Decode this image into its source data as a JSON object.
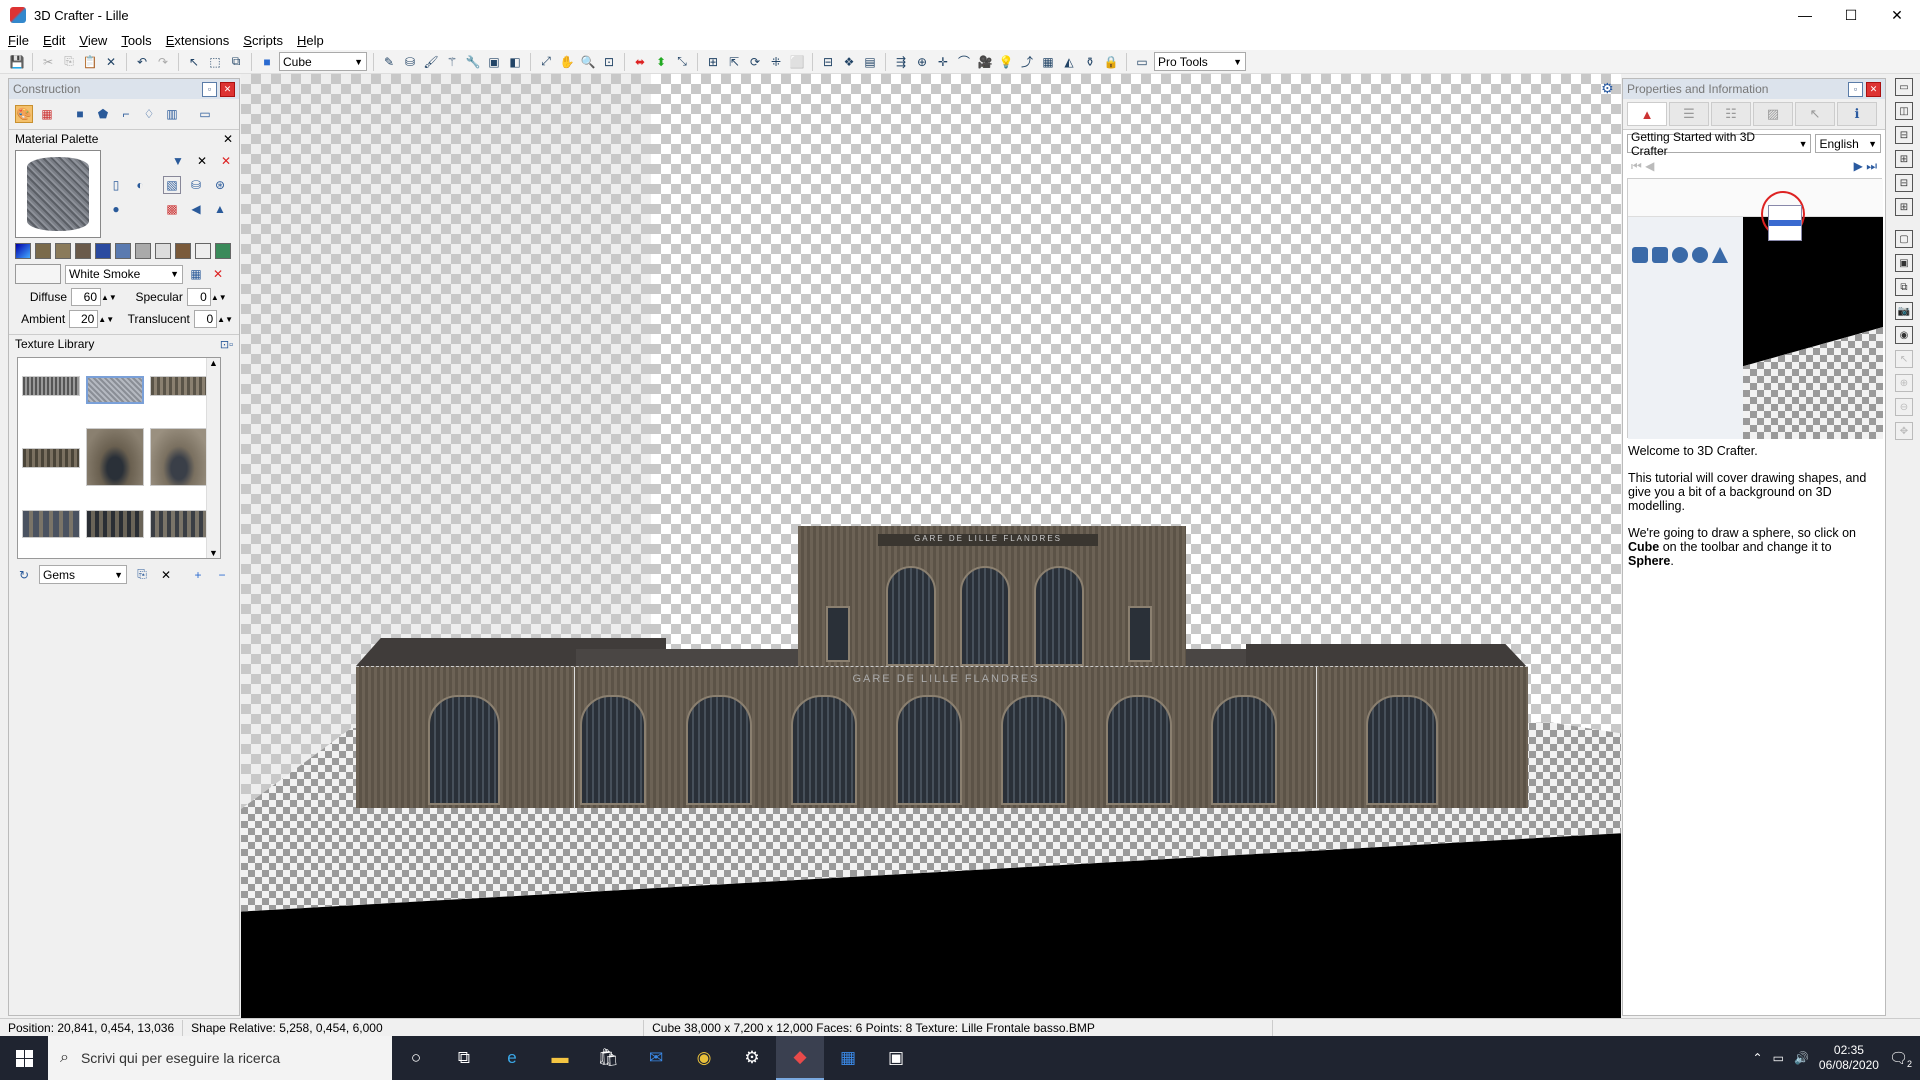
{
  "window": {
    "title": "3D Crafter - Lille",
    "controls": [
      "—",
      "☐",
      "✕"
    ]
  },
  "menu": [
    "File",
    "Edit",
    "View",
    "Tools",
    "Extensions",
    "Scripts",
    "Help"
  ],
  "toolbar": {
    "shape_combo": "Cube",
    "tools_combo": "Pro Tools"
  },
  "construction": {
    "title": "Construction",
    "material_palette": {
      "title": "Material Palette",
      "color_name": "White Smoke",
      "diffuse_label": "Diffuse",
      "diffuse": "60",
      "specular_label": "Specular",
      "specular": "0",
      "ambient_label": "Ambient",
      "ambient": "20",
      "translucent_label": "Translucent",
      "translucent": "0"
    },
    "texture_library": {
      "title": "Texture Library",
      "category": "Gems"
    }
  },
  "properties": {
    "title": "Properties and Information",
    "tutorial_combo": "Getting Started with 3D Crafter",
    "language_combo": "English",
    "tutorial": {
      "p1": "Welcome to 3D Crafter.",
      "p2": "This tutorial will cover drawing shapes, and give you a bit of a background on 3D modelling.",
      "p3_a": "We're going to draw a sphere, so click on ",
      "p3_b": "Cube",
      "p3_c": " on the toolbar and change it to ",
      "p3_d": "Sphere",
      "p3_e": "."
    }
  },
  "viewport": {
    "sign_top": "GARE DE LILLE FLANDRES",
    "sign_main": "GARE DE LILLE FLANDRES"
  },
  "status": {
    "position": "Position: 20,841, 0,454, 13,036",
    "shape_relative": "Shape Relative: 5,258, 0,454, 6,000",
    "shape_info": "Cube 38,000 x 7,200 x 12,000  Faces: 6  Points: 8  Texture: Lille Frontale basso.BMP"
  },
  "taskbar": {
    "search_placeholder": "Scrivi qui per eseguire la ricerca",
    "time": "02:35",
    "date": "06/08/2020",
    "notification_count": "2"
  },
  "colors": {
    "title_bg": "#ffffff",
    "panel_header": "#dce3ec",
    "taskbar": "#1f2430",
    "close_red": "#d33333",
    "link_blue": "#2a5aa0"
  }
}
